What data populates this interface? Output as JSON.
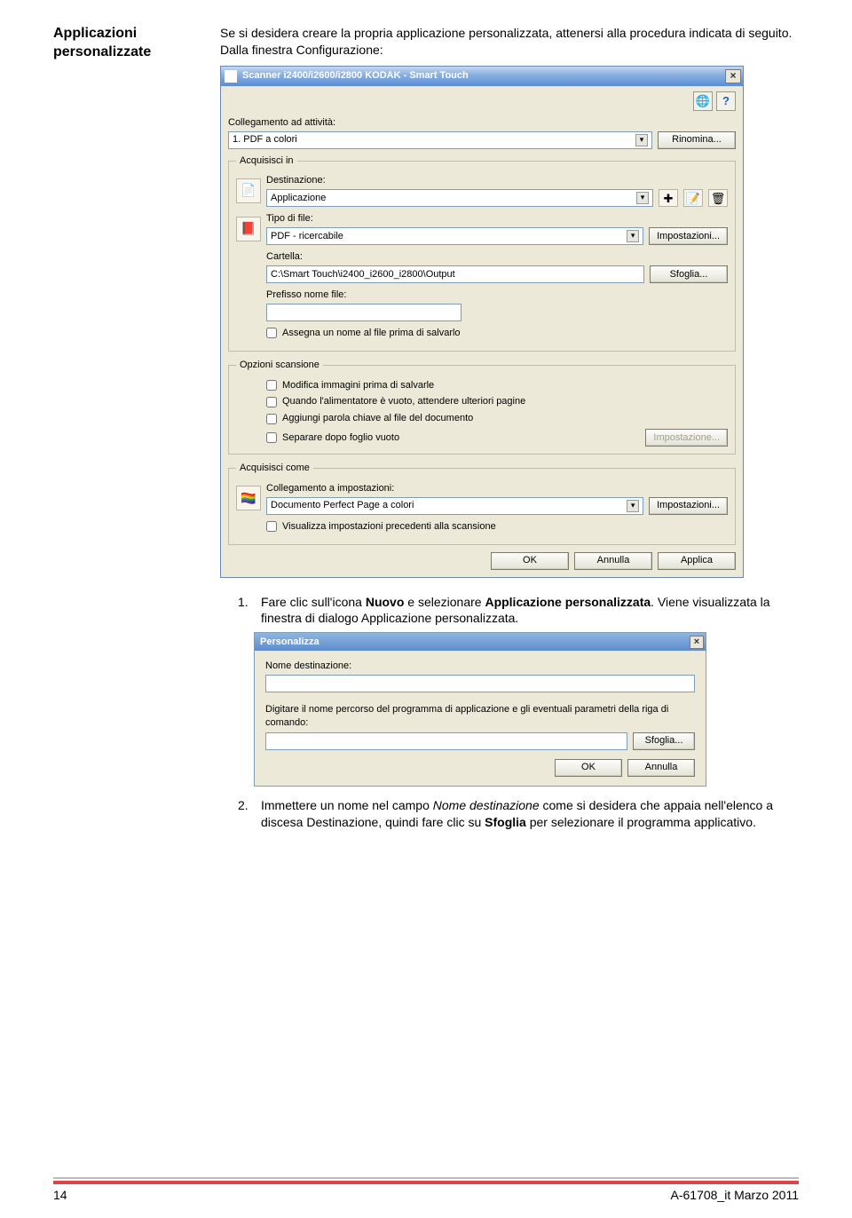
{
  "doc": {
    "side_heading": "Applicazioni personalizzate",
    "intro": "Se si desidera creare la propria applicazione personalizzata, attenersi alla procedura indicata di seguito. Dalla finestra Configurazione:",
    "step1_num": "1.",
    "step1_text": "Fare clic sull'icona Nuovo e selezionare Applicazione personalizzata. Viene visualizzata la finestra di dialogo Applicazione personalizzata.",
    "step2_num": "2.",
    "step2_text": "Immettere un nome nel campo Nome destinazione come si desidera che appaia nell'elenco a discesa Destinazione, quindi fare clic su Sfoglia per selezionare il programma applicativo.",
    "page_num": "14",
    "doc_code": "A-61708_it  Marzo 2011"
  },
  "win": {
    "title": "Scanner i2400/i2600/i2800 KODAK - Smart Touch",
    "close": "×",
    "icon_globe": "🌐",
    "icon_help": "?",
    "attivita_label": "Collegamento ad attività:",
    "attivita_value": "1. PDF a colori",
    "rinomina": "Rinomina...",
    "acquisisci_in": "Acquisisci in",
    "dest_label": "Destinazione:",
    "dest_value": "Applicazione",
    "icon_doc": "📄",
    "icon_plus": "✚",
    "icon_edit": "📝",
    "icon_trash": "🗑",
    "tipo_label": "Tipo di file:",
    "tipo_value": "PDF - ricercabile",
    "impostazioni": "Impostazioni...",
    "icon_pdf": "📕",
    "cartella_label": "Cartella:",
    "cartella_value": "C:\\Smart Touch\\i2400_i2600_i2800\\Output",
    "sfoglia": "Sfoglia...",
    "prefisso_label": "Prefisso nome file:",
    "prefisso_value": "",
    "chk_assegna": "Assegna un nome al file prima di salvarlo",
    "opzioni_scansione": "Opzioni scansione",
    "chk_mod": "Modifica immagini prima di salvarle",
    "chk_ali": "Quando l'alimentatore è vuoto, attendere ulteriori pagine",
    "chk_parola": "Aggiungi parola chiave al file del documento",
    "chk_sep": "Separare dopo foglio vuoto",
    "impostazione_disabled": "Impostazione...",
    "acquisisci_come": "Acquisisci come",
    "coll_label": "Collegamento a impostazioni:",
    "coll_value": "Documento Perfect Page a colori",
    "chk_vis": "Visualizza impostazioni precedenti alla scansione",
    "icon_color": "🏳️‍🌈",
    "ok": "OK",
    "annulla": "Annulla",
    "applica": "Applica"
  },
  "dlg2": {
    "title": "Personalizza",
    "close": "×",
    "nome_label": "Nome destinazione:",
    "nome_value": "",
    "prog_label": "Digitare il nome percorso del programma di applicazione e gli eventuali parametri della riga di comando:",
    "prog_value": "",
    "sfoglia": "Sfoglia...",
    "ok": "OK",
    "annulla": "Annulla"
  }
}
